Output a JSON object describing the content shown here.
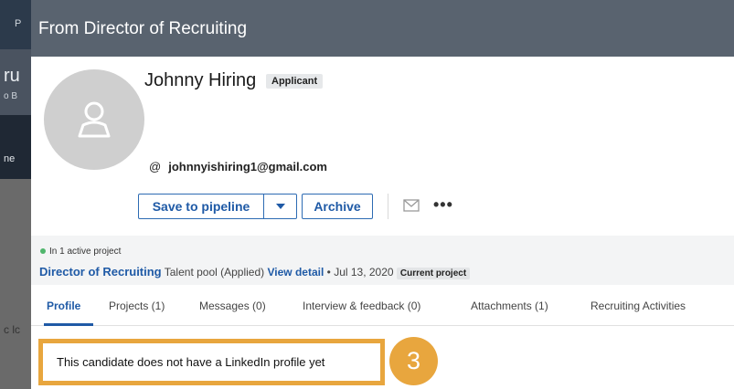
{
  "background": {
    "tab_initial": "P",
    "heading_fragment": "ru",
    "sub_fragment": "o B",
    "row_fragment": "ne",
    "side_fragment": "c lc"
  },
  "panel": {
    "title": "From Director of Recruiting"
  },
  "candidate": {
    "name": "Johnny Hiring",
    "badge": "Applicant",
    "email_icon": "@",
    "email": "johnnyishiring1@gmail.com"
  },
  "actions": {
    "save_label": "Save to pipeline",
    "archive_label": "Archive",
    "more_label": "•••"
  },
  "project": {
    "active_text": "In 1 active project",
    "name": "Director of Recruiting",
    "pool": "Talent pool (Applied)",
    "view_detail": "View detail",
    "date": "• Jul 13, 2020",
    "current": "Current project",
    "status_color": "#4fb56c"
  },
  "tabs": [
    {
      "label": "Profile",
      "active": true
    },
    {
      "label": "Projects (1)"
    },
    {
      "label": "Messages (0)"
    },
    {
      "label": "Interview & feedback (0)"
    },
    {
      "label": "Attachments (1)"
    },
    {
      "label": "Recruiting Activities"
    }
  ],
  "notice": {
    "text": "This candidate does not have a LinkedIn profile yet",
    "step_number": "3",
    "highlight_color": "#e8a63e"
  },
  "colors": {
    "header": "#59636f",
    "accent": "#1f5aa6"
  }
}
